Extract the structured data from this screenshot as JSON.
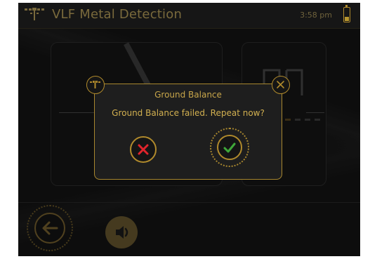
{
  "header": {
    "title": "VLF Metal Detection",
    "time": "3:58 pm"
  },
  "dialog": {
    "title": "Ground Balance",
    "message": "Ground Balance failed. Repeat now?"
  },
  "icons": {
    "logo": "detector-logo-icon",
    "battery": "battery-icon",
    "dialog": "detector-icon",
    "close": "close-icon",
    "cancel": "x-icon",
    "confirm": "check-icon",
    "back": "back-arrow-icon",
    "sound": "speaker-icon"
  },
  "colors": {
    "accent": "#b08a2c",
    "cancel": "#e0242c",
    "confirm": "#3fa83a"
  }
}
